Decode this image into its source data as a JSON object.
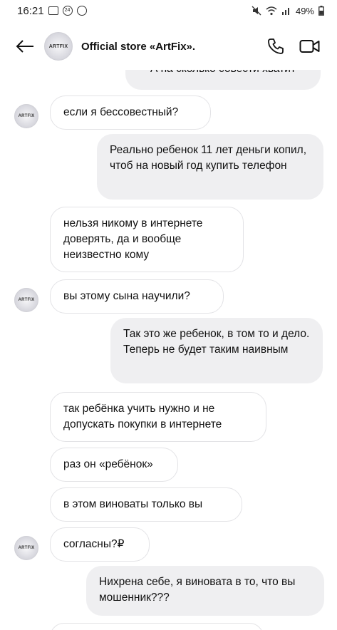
{
  "status": {
    "time": "16:21",
    "notif_badge": "24",
    "battery": "49%"
  },
  "header": {
    "avatar_text": "ARTFIX",
    "title": "Official store «ArtFix».",
    "icons": [
      "back-arrow-icon",
      "phone-icon",
      "video-icon"
    ]
  },
  "messages": [
    {
      "side": "out",
      "text": "А на сколько совести хватит"
    },
    {
      "side": "in",
      "text": "если я бессовестный?"
    },
    {
      "side": "out",
      "text": "Реально ребенок 11 лет деньги копил, чтоб на новый год купить телефон"
    },
    {
      "side": "in",
      "text": "нельзя никому в интернете доверять, да и вообще неизвестно кому"
    },
    {
      "side": "in",
      "text": "вы этому сына научили?"
    },
    {
      "side": "out",
      "text": "Так это же ребенок, в том то и дело. Теперь не будет таким наивным"
    },
    {
      "side": "in",
      "text": "так ребёнка учить нужно и не допускать покупки в интернете"
    },
    {
      "side": "in",
      "text": "раз он «ребёнок»"
    },
    {
      "side": "in",
      "text": "в этом виноваты только вы"
    },
    {
      "side": "in",
      "text": "согласны?₽"
    },
    {
      "side": "out",
      "text": "Нихрена себе, я виновата в то, что вы мошенник???"
    }
  ]
}
